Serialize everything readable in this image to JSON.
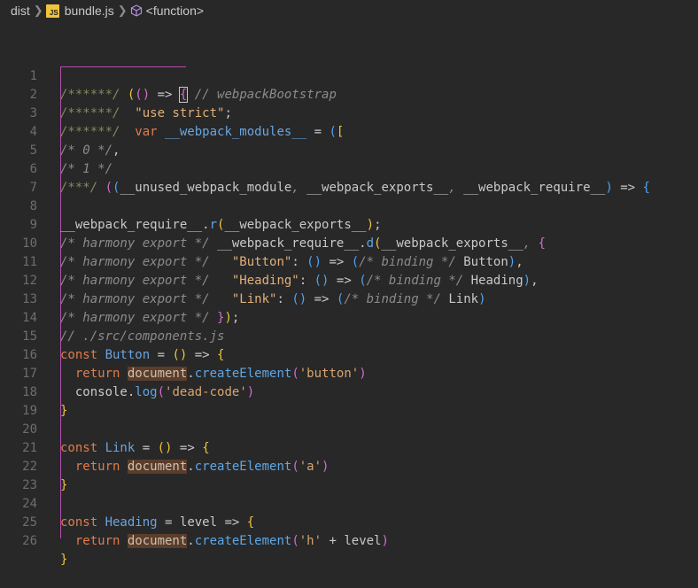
{
  "breadcrumb": {
    "items": [
      {
        "label": "dist"
      },
      {
        "label": "bundle.js",
        "badge": "JS"
      },
      {
        "label": "<function>"
      }
    ]
  },
  "editor": {
    "lines": [
      {
        "n": "1"
      },
      {
        "n": "2"
      },
      {
        "n": "3"
      },
      {
        "n": "4"
      },
      {
        "n": "5"
      },
      {
        "n": "6"
      },
      {
        "n": "7"
      },
      {
        "n": "8"
      },
      {
        "n": "9"
      },
      {
        "n": "10"
      },
      {
        "n": "11"
      },
      {
        "n": "12"
      },
      {
        "n": "13"
      },
      {
        "n": "14"
      },
      {
        "n": "15"
      },
      {
        "n": "16"
      },
      {
        "n": "17"
      },
      {
        "n": "18"
      },
      {
        "n": "19"
      },
      {
        "n": "20"
      },
      {
        "n": "21"
      },
      {
        "n": "22"
      },
      {
        "n": "23"
      },
      {
        "n": "24"
      },
      {
        "n": "25"
      },
      {
        "n": "26"
      }
    ],
    "code": {
      "l1": [
        "/******/ ",
        "(",
        "(",
        ")",
        " => ",
        "{",
        " // webpackBootstrap"
      ],
      "l2": [
        "/******/ ",
        " \"use strict\"",
        ";"
      ],
      "l3": [
        "/******/ ",
        " var ",
        "__webpack_modules__",
        " = ",
        "(",
        "["
      ],
      "l4": [
        "/* 0 */",
        ","
      ],
      "l5": [
        "/* 1 */"
      ],
      "l6": [
        "/***/ ",
        "(",
        "(",
        "__unused_webpack_module",
        ", ",
        "__webpack_exports__",
        ", ",
        "__webpack_require__",
        ")",
        " => ",
        "{"
      ],
      "l7": [],
      "l8": [
        "__webpack_require__",
        ".",
        "r",
        "(",
        "__webpack_exports__",
        ")",
        ";"
      ],
      "l9": [
        "/* harmony export */ ",
        "__webpack_require__",
        ".",
        "d",
        "(",
        "__webpack_exports__",
        ", ",
        "{"
      ],
      "l10": [
        "/* harmony export */ ",
        "  \"Button\"",
        ": ",
        "(",
        ")",
        " => ",
        "(",
        "/* binding */ ",
        "Button",
        ")",
        ","
      ],
      "l11": [
        "/* harmony export */ ",
        "  \"Heading\"",
        ": ",
        "(",
        ")",
        " => ",
        "(",
        "/* binding */ ",
        "Heading",
        ")",
        ","
      ],
      "l12": [
        "/* harmony export */ ",
        "  \"Link\"",
        ": ",
        "(",
        ")",
        " => ",
        "(",
        "/* binding */ ",
        "Link",
        ")"
      ],
      "l13": [
        "/* harmony export */ ",
        "}",
        ")",
        ";"
      ],
      "l14": [
        "// ./src/components.js"
      ],
      "l15": [
        "const ",
        "Button",
        " = ",
        "(",
        ")",
        " => ",
        "{"
      ],
      "l16": [
        "  return ",
        "document",
        ".",
        "createElement",
        "(",
        "'button'",
        ")"
      ],
      "l17": [
        "  console",
        ".",
        "log",
        "(",
        "'dead-code'",
        ")"
      ],
      "l18": [
        "}"
      ],
      "l19": [],
      "l20": [
        "const ",
        "Link",
        " = ",
        "(",
        ")",
        " => ",
        "{"
      ],
      "l21": [
        "  return ",
        "document",
        ".",
        "createElement",
        "(",
        "'a'",
        ")"
      ],
      "l22": [
        "}"
      ],
      "l23": [],
      "l24": [
        "const ",
        "Heading",
        " = ",
        "level",
        " => ",
        "{"
      ],
      "l25": [
        "  return ",
        "document",
        ".",
        "createElement",
        "(",
        "'h'",
        " + ",
        "level",
        ")"
      ],
      "l26": [
        "}"
      ]
    }
  },
  "colors": {
    "background": "#282828",
    "keyword": "#e07c4c",
    "variable": "#6aa4e0",
    "string": "#e0b07a",
    "comment": "#8b8b8b",
    "bracket_yellow": "#f0c33c",
    "bracket_purple": "#d36bd0",
    "bracket_blue": "#4ea2f0",
    "highlight": "#5a3d2a",
    "guide": "#b04fa8"
  }
}
